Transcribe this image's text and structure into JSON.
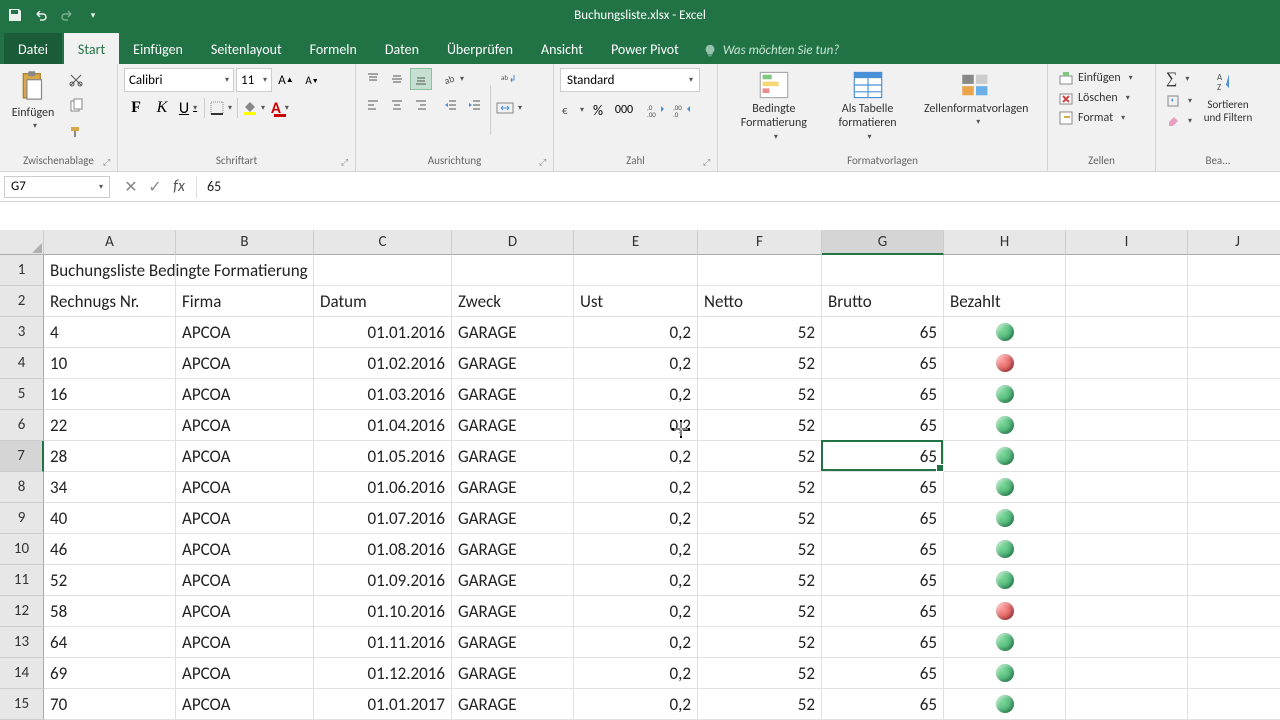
{
  "titlebar": {
    "title": "Buchungsliste.xlsx - Excel"
  },
  "tabs": {
    "file": "Datei",
    "items": [
      "Start",
      "Einfügen",
      "Seitenlayout",
      "Formeln",
      "Daten",
      "Überprüfen",
      "Ansicht",
      "Power Pivot"
    ],
    "active": 0,
    "tellme": "Was möchten Sie tun?"
  },
  "ribbon": {
    "clipboard": {
      "label": "Zwischenablage",
      "paste": "Einfügen"
    },
    "font": {
      "label": "Schriftart",
      "name": "Calibri",
      "size": "11"
    },
    "alignment": {
      "label": "Ausrichtung"
    },
    "number": {
      "label": "Zahl",
      "format": "Standard"
    },
    "styles": {
      "label": "Formatvorlagen",
      "cond": "Bedingte Formatierung",
      "table": "Als Tabelle formatieren",
      "cellstyles": "Zellenformatvorlagen"
    },
    "cells": {
      "label": "Zellen",
      "insert": "Einfügen",
      "delete": "Löschen",
      "format": "Format"
    },
    "editing": {
      "label": "Bea...",
      "sort": "Sortieren und Filtern"
    }
  },
  "formula_bar": {
    "cellref": "G7",
    "value": "65"
  },
  "columns": [
    "A",
    "B",
    "C",
    "D",
    "E",
    "F",
    "G",
    "H",
    "I",
    "J"
  ],
  "selected_col": "G",
  "selected_row": 7,
  "selected_cell": {
    "col": 6,
    "row": 4
  },
  "headers": {
    "title": "Buchungsliste Bedingte Formatierung",
    "cols": [
      "Rechnugs Nr.",
      "Firma",
      "Datum",
      "Zweck",
      "Ust",
      "Netto",
      "Brutto",
      "Bezahlt"
    ]
  },
  "rows": [
    {
      "nr": "4",
      "firma": "APCOA",
      "datum": "01.01.2016",
      "zweck": "GARAGE",
      "ust": "0,2",
      "netto": "52",
      "brutto": "65",
      "status": "green"
    },
    {
      "nr": "10",
      "firma": "APCOA",
      "datum": "01.02.2016",
      "zweck": "GARAGE",
      "ust": "0,2",
      "netto": "52",
      "brutto": "65",
      "status": "red"
    },
    {
      "nr": "16",
      "firma": "APCOA",
      "datum": "01.03.2016",
      "zweck": "GARAGE",
      "ust": "0,2",
      "netto": "52",
      "brutto": "65",
      "status": "green"
    },
    {
      "nr": "22",
      "firma": "APCOA",
      "datum": "01.04.2016",
      "zweck": "GARAGE",
      "ust": "0,2",
      "netto": "52",
      "brutto": "65",
      "status": "green"
    },
    {
      "nr": "28",
      "firma": "APCOA",
      "datum": "01.05.2016",
      "zweck": "GARAGE",
      "ust": "0,2",
      "netto": "52",
      "brutto": "65",
      "status": "green"
    },
    {
      "nr": "34",
      "firma": "APCOA",
      "datum": "01.06.2016",
      "zweck": "GARAGE",
      "ust": "0,2",
      "netto": "52",
      "brutto": "65",
      "status": "green"
    },
    {
      "nr": "40",
      "firma": "APCOA",
      "datum": "01.07.2016",
      "zweck": "GARAGE",
      "ust": "0,2",
      "netto": "52",
      "brutto": "65",
      "status": "green"
    },
    {
      "nr": "46",
      "firma": "APCOA",
      "datum": "01.08.2016",
      "zweck": "GARAGE",
      "ust": "0,2",
      "netto": "52",
      "brutto": "65",
      "status": "green"
    },
    {
      "nr": "52",
      "firma": "APCOA",
      "datum": "01.09.2016",
      "zweck": "GARAGE",
      "ust": "0,2",
      "netto": "52",
      "brutto": "65",
      "status": "green"
    },
    {
      "nr": "58",
      "firma": "APCOA",
      "datum": "01.10.2016",
      "zweck": "GARAGE",
      "ust": "0,2",
      "netto": "52",
      "brutto": "65",
      "status": "red"
    },
    {
      "nr": "64",
      "firma": "APCOA",
      "datum": "01.11.2016",
      "zweck": "GARAGE",
      "ust": "0,2",
      "netto": "52",
      "brutto": "65",
      "status": "green"
    },
    {
      "nr": "69",
      "firma": "APCOA",
      "datum": "01.12.2016",
      "zweck": "GARAGE",
      "ust": "0,2",
      "netto": "52",
      "brutto": "65",
      "status": "green"
    },
    {
      "nr": "70",
      "firma": "APCOA",
      "datum": "01.01.2017",
      "zweck": "GARAGE",
      "ust": "0,2",
      "netto": "52",
      "brutto": "65",
      "status": "green"
    }
  ]
}
